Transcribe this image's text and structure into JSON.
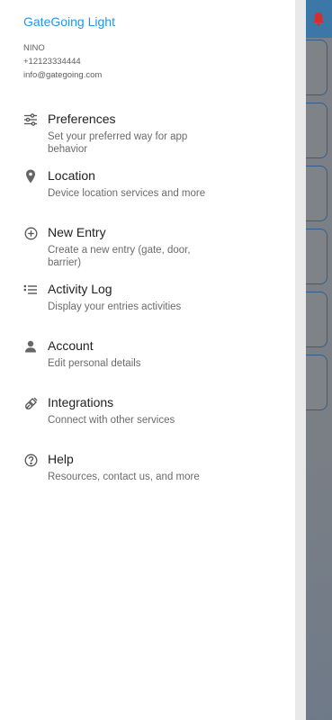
{
  "drawer": {
    "app_title": "GateGoing Light",
    "user": {
      "name": "NINO",
      "phone": "+12123334444",
      "email": "info@gatego­ing.com"
    },
    "items": [
      {
        "icon": "sliders-icon",
        "title": "Preferences",
        "subtitle": "Set your preferred way for app behavior"
      },
      {
        "icon": "location-pin-icon",
        "title": "Location",
        "subtitle": "Device location services and more"
      },
      {
        "icon": "add-circle-icon",
        "title": "New Entry",
        "subtitle": "Create a new entry (gate, door, barrier)"
      },
      {
        "icon": "list-icon",
        "title": "Activity Log",
        "subtitle": "Display your entries activities"
      },
      {
        "icon": "person-icon",
        "title": "Account",
        "subtitle": "Edit personal details"
      },
      {
        "icon": "plug-icon",
        "title": "Integrations",
        "subtitle": "Connect with other services"
      },
      {
        "icon": "help-circle-icon",
        "title": "Help",
        "subtitle": "Resources, contact us, and more"
      }
    ]
  },
  "background": {
    "notification_icon": "bell-icon",
    "accent_color": "#3b78a8",
    "bell_color": "#d32f2f"
  }
}
